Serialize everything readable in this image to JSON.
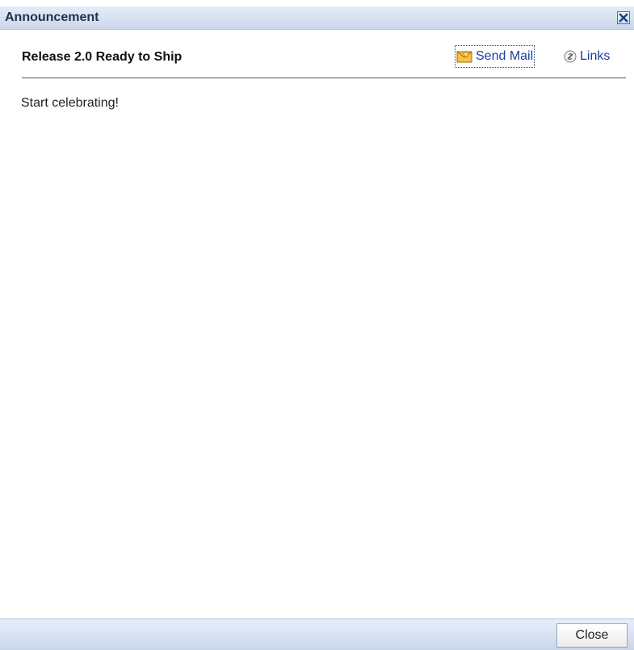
{
  "dialog": {
    "title": "Announcement",
    "close_icon": "close-x-icon"
  },
  "announcement": {
    "subject": "Release 2.0 Ready to Ship",
    "body": "Start celebrating!"
  },
  "actions": {
    "send_mail_label": "Send Mail",
    "send_mail_icon": "envelope-icon",
    "links_label": "Links",
    "links_icon": "link-icon"
  },
  "footer": {
    "close_label": "Close"
  },
  "colors": {
    "titlebar": "#cbd8eb",
    "link": "#1a3fa3",
    "footer": "#c9d6ea"
  }
}
